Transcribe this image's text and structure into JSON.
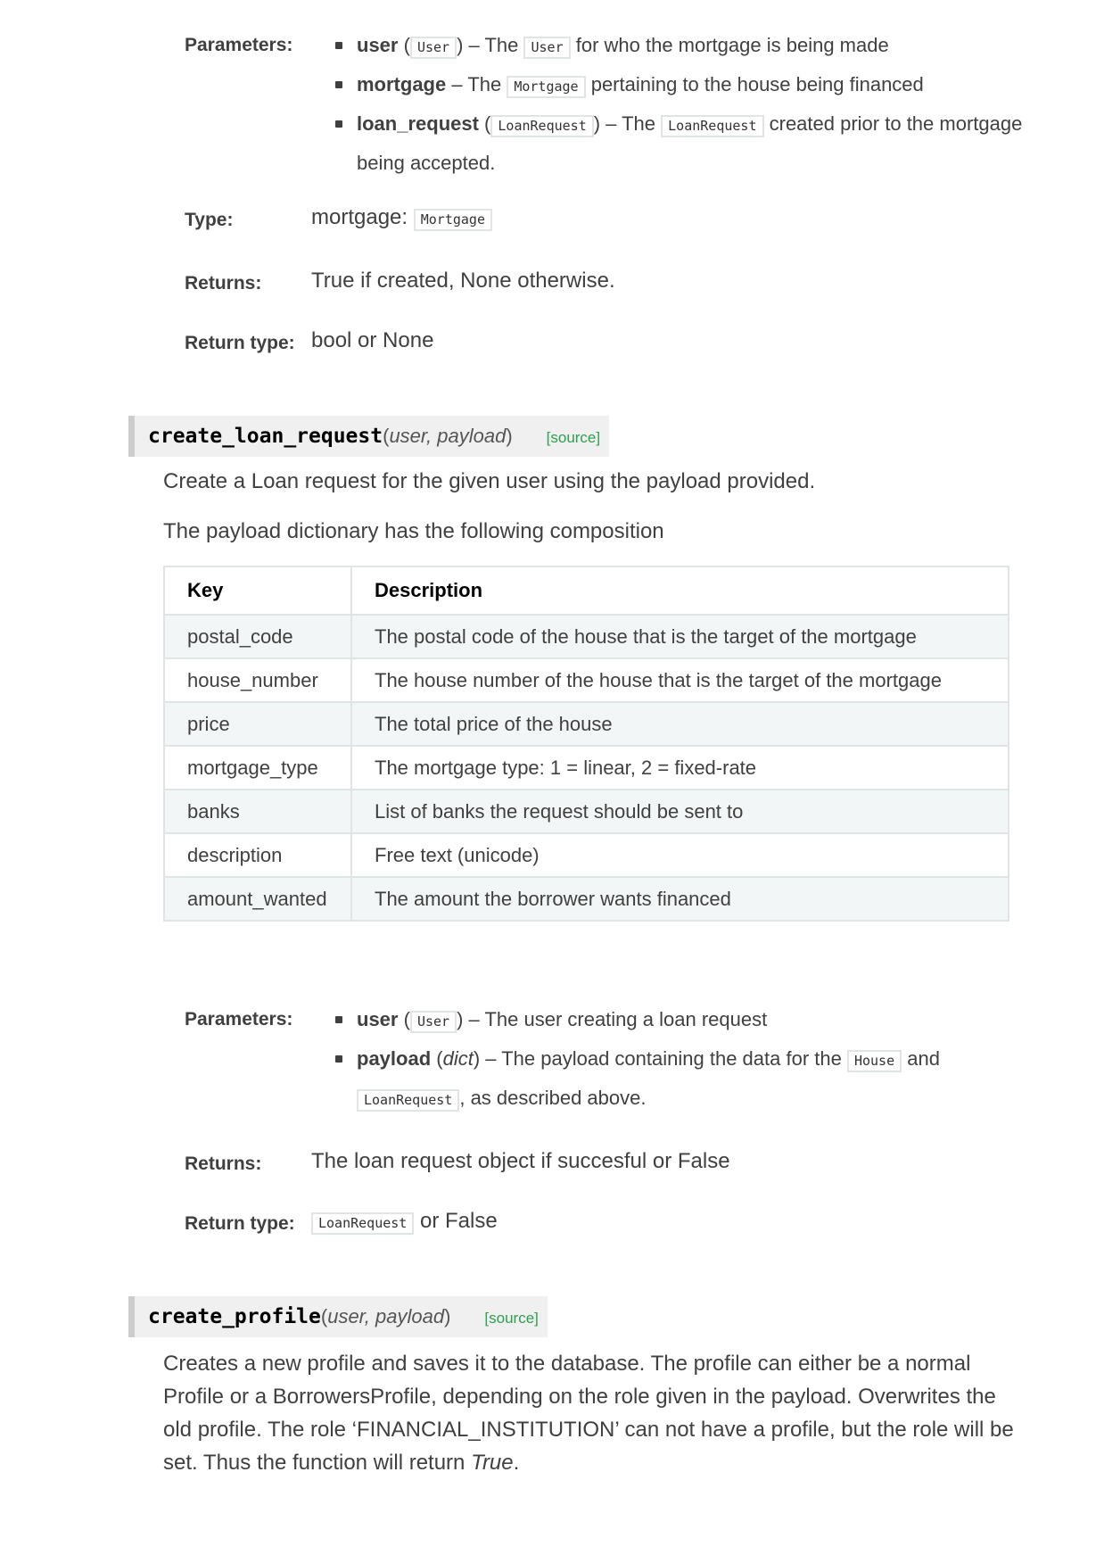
{
  "section1": {
    "parameters_label": "Parameters:",
    "params": [
      {
        "name": "user",
        "open": " (",
        "type": "User",
        "close": ") – The ",
        "code": "User",
        "rest": " for who the mortgage is being made"
      },
      {
        "name": "mortgage",
        "text1": " – The ",
        "code": "Mortgage",
        "rest": " pertaining to the house being financed"
      },
      {
        "name": "loan_request",
        "open": " (",
        "type": "LoanRequest",
        "close": ") – The ",
        "code": "LoanRequest",
        "rest": " created prior to the mortgage being accepted."
      }
    ],
    "type_label": "Type:",
    "type_text": "mortgage: ",
    "type_code": "Mortgage",
    "returns_label": "Returns:",
    "returns_text": "True if created, None otherwise.",
    "return_type_label": "Return type:",
    "return_type_text": "bool or None"
  },
  "create_loan_request": {
    "name": "create_loan_request",
    "open_paren": "(",
    "args": "user, payload",
    "close_paren": ")",
    "source": "[source]",
    "description": "Create a Loan request for the given user using the payload provided.",
    "composition": "The payload dictionary has the following composition",
    "table": {
      "headers": [
        "Key",
        "Description"
      ],
      "rows": [
        [
          "postal_code",
          "The postal code of the house that is the target of the mortgage"
        ],
        [
          "house_number",
          "The house number of the house that is the target of the mortgage"
        ],
        [
          "price",
          "The total price of the house"
        ],
        [
          "mortgage_type",
          "The mortgage type: 1 = linear, 2 = fixed-rate"
        ],
        [
          "banks",
          "List of banks the request should be sent to"
        ],
        [
          "description",
          "Free text (unicode)"
        ],
        [
          "amount_wanted",
          "The amount the borrower wants financed"
        ]
      ]
    },
    "parameters_label": "Parameters:",
    "params": [
      {
        "name": "user",
        "open": " (",
        "type": "User",
        "close": ") – The user creating a loan request"
      },
      {
        "name": "payload",
        "open": " (",
        "type": "dict",
        "close": ") – The payload containing the data for the ",
        "code": "House",
        "mid": " and ",
        "code2": "LoanRequest",
        "rest": ", as described above."
      }
    ],
    "returns_label": "Returns:",
    "returns_text": "The loan request object if succesful or False",
    "return_type_label": "Return type:",
    "return_type_code": "LoanRequest",
    "return_type_rest": " or False"
  },
  "create_profile": {
    "name": "create_profile",
    "open_paren": "(",
    "args": "user, payload",
    "close_paren": ")",
    "source": "[source]",
    "description": "Creates a new profile and saves it to the database. The profile can either be a normal Profile or a BorrowersProfile, depending on the role given in the payload. Overwrites the old profile. The role ‘FINANCIAL_INSTITUTION’ can not have a profile, but the role will be set. Thus the function will return ",
    "description_em": "True",
    "description_end": "."
  }
}
